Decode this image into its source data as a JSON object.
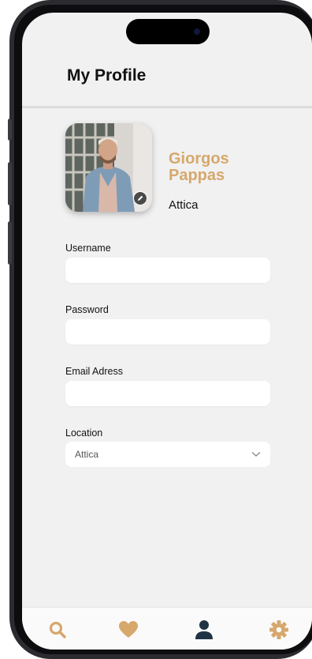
{
  "header": {
    "title": "My Profile"
  },
  "profile": {
    "name": "Giorgos Pappas",
    "region": "Attica"
  },
  "form": {
    "username_label": "Username",
    "username_value": "",
    "password_label": "Password",
    "password_value": "",
    "email_label": "Email Adress",
    "email_value": "",
    "location_label": "Location",
    "location_value": "Attica"
  },
  "nav": {
    "items": [
      {
        "icon": "search-icon",
        "active": false
      },
      {
        "icon": "heart-icon",
        "active": false
      },
      {
        "icon": "person-icon",
        "active": true
      },
      {
        "icon": "gear-icon",
        "active": false
      }
    ]
  },
  "colors": {
    "accent": "#d6a86c",
    "active_nav": "#1f3344",
    "background": "#f1f1f1"
  }
}
